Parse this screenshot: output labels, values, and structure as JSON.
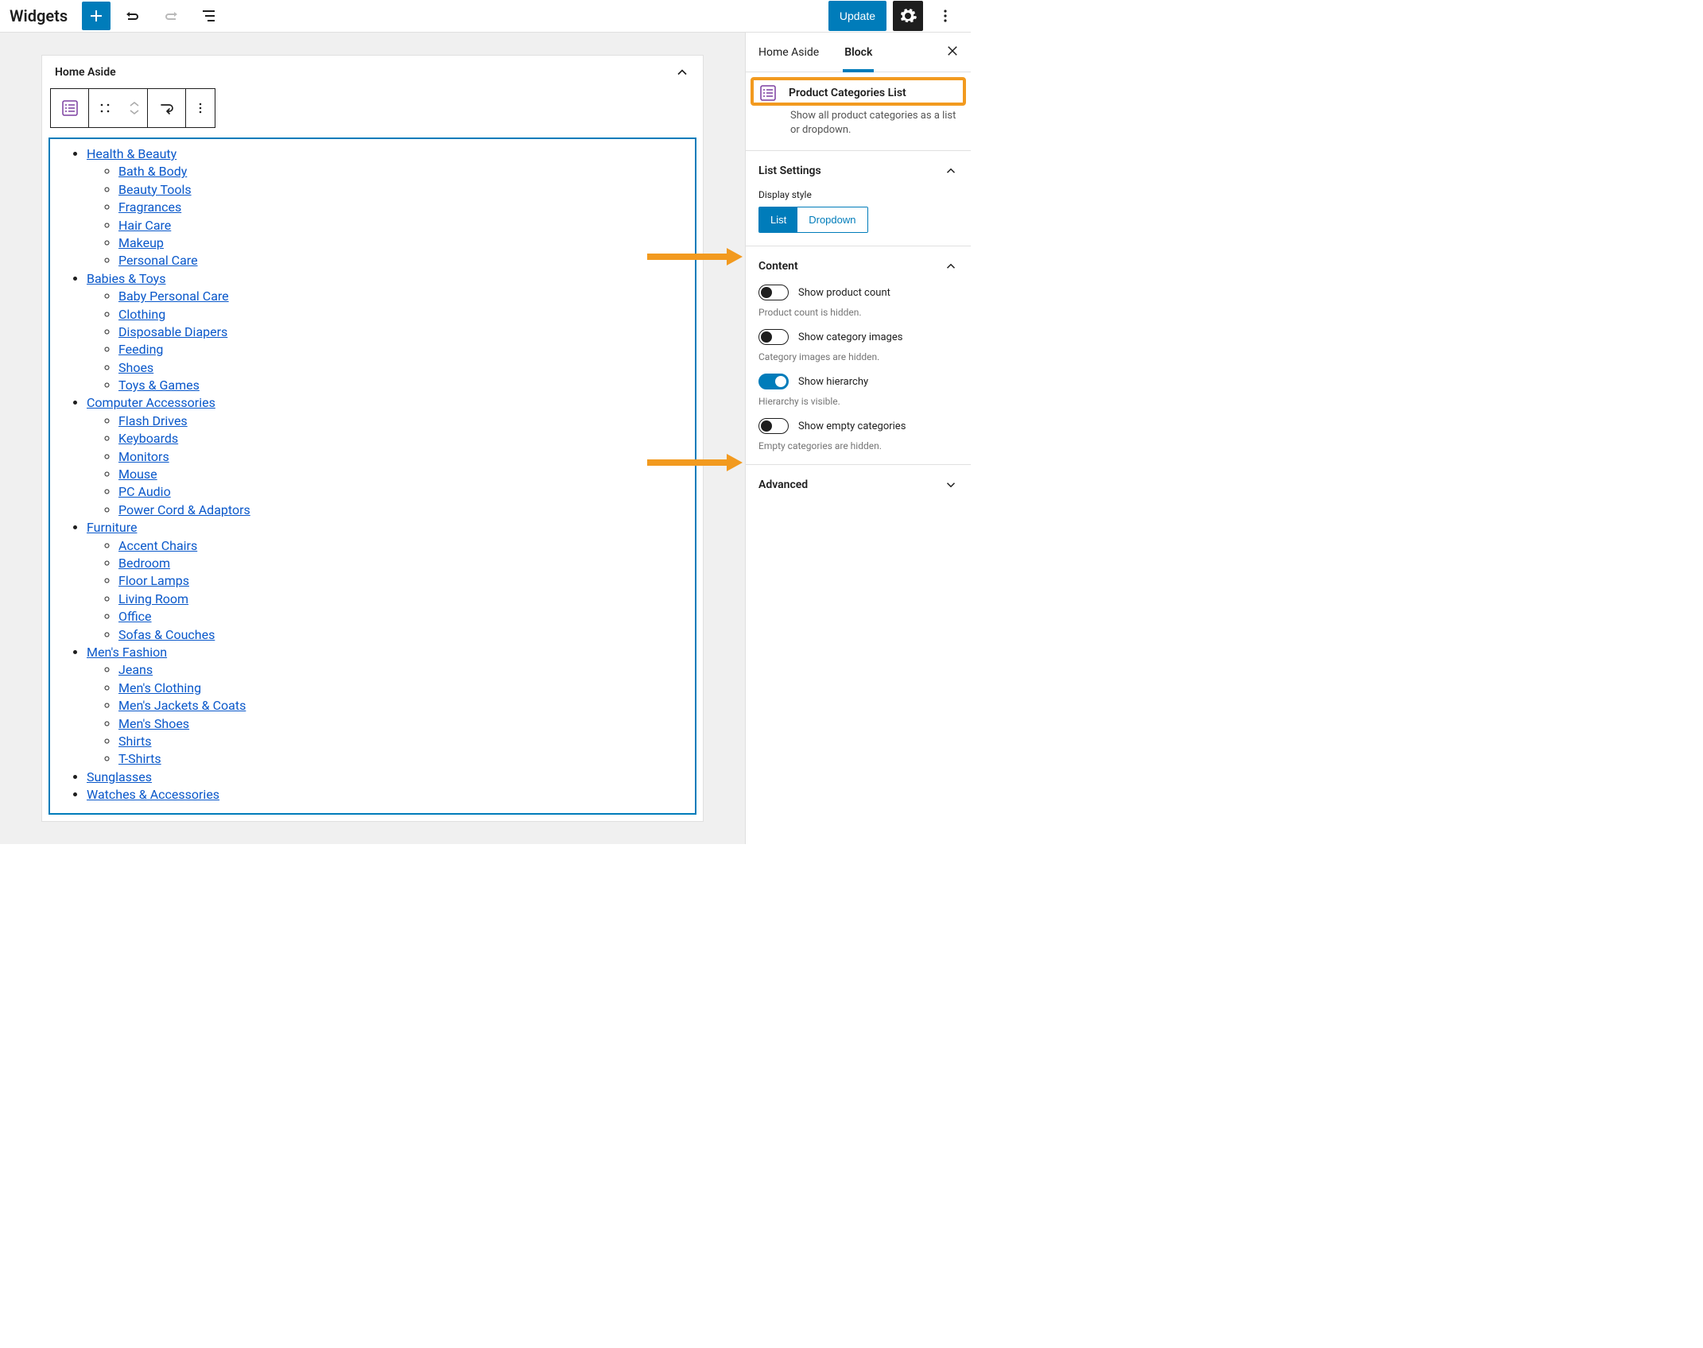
{
  "topbar": {
    "title": "Widgets",
    "update_label": "Update"
  },
  "widget_area": {
    "title": "Home Aside"
  },
  "categories": [
    {
      "name": "Health & Beauty",
      "children": [
        "Bath & Body",
        "Beauty Tools",
        "Fragrances",
        "Hair Care",
        "Makeup",
        "Personal Care"
      ]
    },
    {
      "name": "Babies & Toys",
      "children": [
        "Baby Personal Care",
        "Clothing",
        "Disposable Diapers",
        "Feeding",
        "Shoes",
        "Toys & Games"
      ]
    },
    {
      "name": "Computer Accessories",
      "children": [
        "Flash Drives",
        "Keyboards",
        "Monitors",
        "Mouse",
        "PC Audio",
        "Power Cord & Adaptors"
      ]
    },
    {
      "name": "Furniture",
      "children": [
        "Accent Chairs",
        "Bedroom",
        "Floor Lamps",
        "Living Room",
        "Office",
        "Sofas & Couches"
      ]
    },
    {
      "name": "Men's Fashion",
      "children": [
        "Jeans",
        "Men's Clothing",
        "Men's Jackets & Coats",
        "Men's Shoes",
        "Shirts",
        "T-Shirts"
      ]
    },
    {
      "name": "Sunglasses",
      "children": []
    },
    {
      "name": "Watches & Accessories",
      "children": []
    }
  ],
  "sidebar": {
    "tabs": {
      "home_aside": "Home Aside",
      "block": "Block"
    },
    "block_card": {
      "title": "Product Categories List",
      "desc": "Show all product categories as a list or dropdown."
    },
    "list_settings": {
      "heading": "List Settings",
      "display_style_label": "Display style",
      "options": {
        "list": "List",
        "dropdown": "Dropdown"
      }
    },
    "content": {
      "heading": "Content",
      "show_product_count": {
        "label": "Show product count",
        "desc": "Product count is hidden.",
        "on": false
      },
      "show_category_images": {
        "label": "Show category images",
        "desc": "Category images are hidden.",
        "on": false
      },
      "show_hierarchy": {
        "label": "Show hierarchy",
        "desc": "Hierarchy is visible.",
        "on": true
      },
      "show_empty": {
        "label": "Show empty categories",
        "desc": "Empty categories are hidden.",
        "on": false
      }
    },
    "advanced": {
      "heading": "Advanced"
    }
  }
}
